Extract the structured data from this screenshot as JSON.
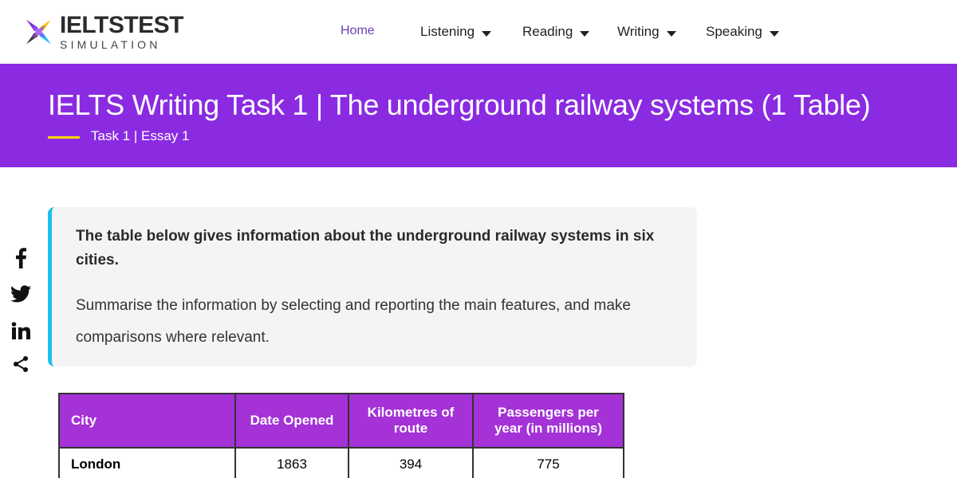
{
  "logo": {
    "main": "IELTSTEST",
    "sub": "SIMULATION"
  },
  "nav": {
    "items": [
      {
        "label": "Home",
        "active": true,
        "dropdown": false
      },
      {
        "label": "Listening",
        "active": false,
        "dropdown": true
      },
      {
        "label": "Reading",
        "active": false,
        "dropdown": true
      },
      {
        "label": "Writing",
        "active": false,
        "dropdown": true
      },
      {
        "label": "Speaking",
        "active": false,
        "dropdown": true
      }
    ]
  },
  "banner": {
    "title": "IELTS Writing Task 1 | The underground railway systems (1 Table)",
    "subtitle": "Task 1 | Essay 1"
  },
  "share": {
    "icons": [
      "facebook-icon",
      "twitter-icon",
      "linkedin-icon",
      "share-icon"
    ]
  },
  "prompt": {
    "bold": "The table below gives information about the underground railway systems in six cities.",
    "text": "Summarise the information by selecting and reporting the main features, and make comparisons where relevant."
  },
  "table": {
    "headers": [
      "City",
      "Date Opened",
      "Kilometres of route",
      "Passengers per year (in millions)"
    ],
    "rows": [
      [
        "London",
        "1863",
        "394",
        "775"
      ]
    ]
  },
  "colors": {
    "banner": "#8a2be2",
    "table_header": "#a432d6",
    "prompt_accent": "#1ec0f0",
    "banner_line": "#ffd400",
    "nav_active": "#6a3fb8"
  }
}
